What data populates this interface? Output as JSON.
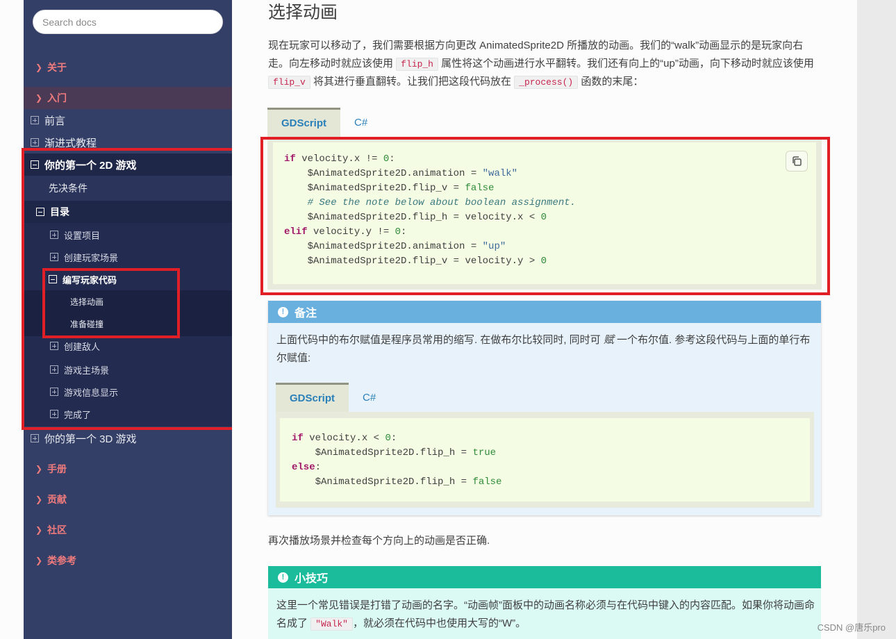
{
  "sidebar": {
    "search_placeholder": "Search docs",
    "captions": {
      "about": "关于",
      "getting_started": "入门",
      "manual": "手册",
      "contributing": "贡献",
      "community": "社区",
      "class_reference": "类参考"
    },
    "getting_started_items": {
      "intro": "前言",
      "step_by_step": "渐进式教程",
      "first_2d_game": "你的第一个 2D 游戏",
      "first_3d_game": "你的第一个 3D 游戏"
    },
    "prerequisites": "先决条件",
    "toc": "目录",
    "toc_items": [
      "设置项目",
      "创建玩家场景",
      "编写玩家代码",
      "创建敌人",
      "游戏主场景",
      "游戏信息显示",
      "完成了"
    ],
    "code_sub_items": [
      "选择动画",
      "准备碰撞"
    ]
  },
  "content": {
    "title": "选择动画",
    "intro_1": "现在玩家可以移动了，我们需要根据方向更改 AnimatedSprite2D 所播放的动画。我们的“walk”动画显示的是玩家向右走。向左移动时就应该使用 ",
    "intro_code_1": "flip_h",
    "intro_2": " 属性将这个动画进行水平翻转。我们还有向上的“up”动画，向下移动时就应该使用 ",
    "intro_code_2": "flip_v",
    "intro_3": " 将其进行垂直翻转。让我们把这段代码放在 ",
    "intro_code_3": "_process()",
    "intro_4": " 函数的末尾：",
    "tab_gdscript": "GDScript",
    "tab_csharp": "C#",
    "note_title": "备注",
    "note_text_1": "上面代码中的布尔赋值是程序员常用的缩写. 在做布尔比较同时, 同时可 ",
    "note_text_em": "赋",
    "note_text_2": " 一个布尔值. 参考这段代码与上面的单行布尔赋值:",
    "after_text": "再次播放场景并检查每个方向上的动画是否正确.",
    "tip_title": "小技巧",
    "tip_text_1": "这里一个常见错误是打错了动画的名字。“动画帧”面板中的动画名称必须与在代码中键入的内容匹配。如果你将动画命名成了 ",
    "tip_code": "\"Walk\"",
    "tip_text_2": "，就必须在代码中也使用大写的“W”。"
  },
  "code1": {
    "l1_kw": "if",
    "l1_rest": " velocity.x != ",
    "l1_num": "0",
    "l1_end": ":",
    "l2_a": "    $AnimatedSprite2D.animation = ",
    "l2_str": "\"walk\"",
    "l3_a": "    $AnimatedSprite2D.flip_v = ",
    "l3_kw": "false",
    "l4_cm": "    # See the note below about boolean assignment.",
    "l5_a": "    $AnimatedSprite2D.flip_h = velocity.x < ",
    "l5_num": "0",
    "l6_kw": "elif",
    "l6_rest": " velocity.y != ",
    "l6_num": "0",
    "l6_end": ":",
    "l7_a": "    $AnimatedSprite2D.animation = ",
    "l7_str": "\"up\"",
    "l8_a": "    $AnimatedSprite2D.flip_v = velocity.y > ",
    "l8_num": "0"
  },
  "code2": {
    "l1_kw": "if",
    "l1_rest": " velocity.x < ",
    "l1_num": "0",
    "l1_end": ":",
    "l2_a": "    $AnimatedSprite2D.flip_h = ",
    "l2_kw": "true",
    "l3_kw": "else",
    "l3_end": ":",
    "l4_a": "    $AnimatedSprite2D.flip_h = ",
    "l4_kw": "false"
  },
  "watermark": "CSDN @唐乐pro"
}
